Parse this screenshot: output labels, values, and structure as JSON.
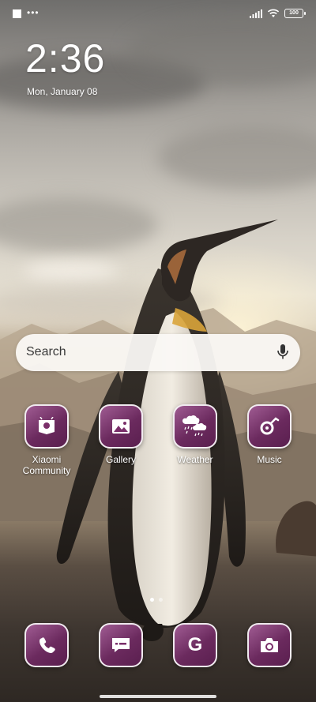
{
  "status_bar": {
    "dots": "•••",
    "battery": "100",
    "icons": [
      "signal-icon",
      "wifi-icon",
      "battery-icon"
    ]
  },
  "lockclock": {
    "time": "2:36",
    "date": "Mon, January 08"
  },
  "search": {
    "placeholder": "Search",
    "icon": "mic-icon"
  },
  "apps": [
    {
      "label": "Xiaomi Community",
      "icon": "community-icon"
    },
    {
      "label": "Gallery",
      "icon": "gallery-icon"
    },
    {
      "label": "Weather",
      "icon": "weather-icon"
    },
    {
      "label": "Music",
      "icon": "music-icon"
    }
  ],
  "dock": [
    {
      "name": "Phone",
      "icon": "phone-icon"
    },
    {
      "name": "Messages",
      "icon": "message-icon"
    },
    {
      "name": "Google",
      "icon": "google-icon",
      "glyph": "G"
    },
    {
      "name": "Camera",
      "icon": "camera-icon"
    }
  ],
  "pager": {
    "pages": 2,
    "current": 1
  },
  "colors": {
    "icon_bg": "#6b2a5e",
    "search_bg": "#faf8f4"
  }
}
